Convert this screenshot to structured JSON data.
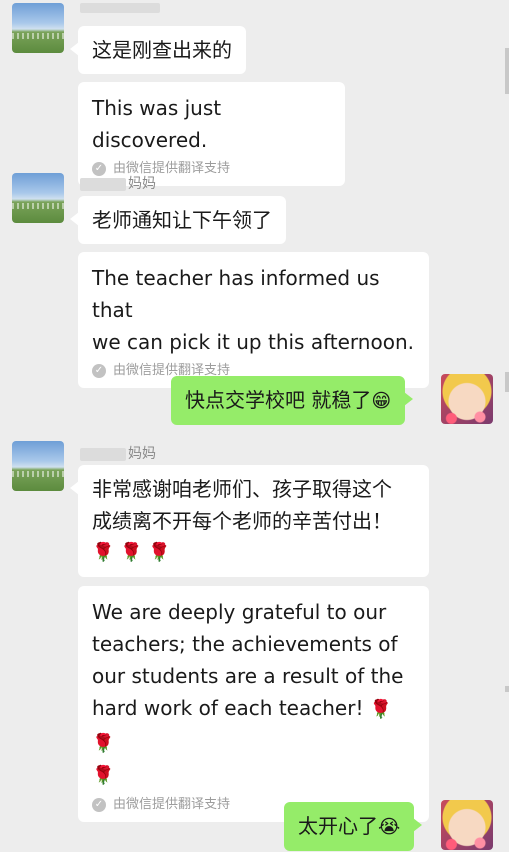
{
  "messages": {
    "m1": {
      "text": "这是刚查出来的",
      "translation": "This was just discovered.",
      "support": "由微信提供翻译支持"
    },
    "m2": {
      "sender_suffix": "妈妈",
      "text": "老师通知让下午领了",
      "translation_line1": "The teacher has informed us that",
      "translation_line2": "we can pick it up this afternoon.",
      "support": "由微信提供翻译支持"
    },
    "m3": {
      "text": "快点交学校吧 就稳了",
      "emoji": "😁"
    },
    "m4": {
      "sender_suffix": "妈妈",
      "text_line1": "非常感谢咱老师们、孩子取得这个",
      "text_line2": "成绩离不开每个老师的辛苦付出！",
      "roses": "🌹 🌹 🌹",
      "translation_line1": "We are deeply grateful to our",
      "translation_line2": "teachers; the achievements of",
      "translation_line3": "our students are a result of the",
      "translation_line4": "hard work of each teacher!",
      "translation_roses_a": "🌹 🌹",
      "translation_roses_b": "🌹",
      "support": "由微信提供翻译支持"
    },
    "m5": {
      "text": "太开心了",
      "emoji": "😭"
    }
  },
  "check_icon": "✓",
  "colors": {
    "background": "#ededed",
    "my_bubble": "#95ec69",
    "their_bubble": "#ffffff",
    "meta_text": "#9d9d9d"
  }
}
